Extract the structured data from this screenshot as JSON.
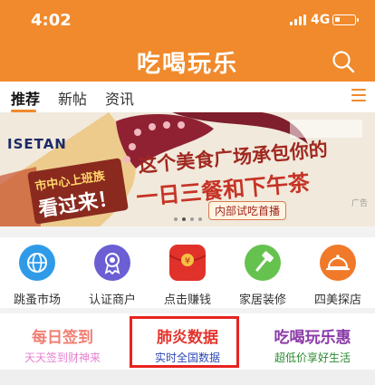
{
  "status_bar": {
    "time": "4:02",
    "network": "4G"
  },
  "header": {
    "title": "吃喝玩乐"
  },
  "tabs": [
    {
      "label": "推荐",
      "active": true
    },
    {
      "label": "新帖",
      "active": false
    },
    {
      "label": "资讯",
      "active": false
    }
  ],
  "banner": {
    "brand": "ISETAN",
    "left_line1": "市中心上班族",
    "left_line2": "看过来！",
    "title": "这个美食广场承包你的",
    "subtitle": "一日三餐和下午茶",
    "tag": "内部试吃首播",
    "ad_label": "广告"
  },
  "quick_links": [
    {
      "label": "跳蚤市场",
      "icon": "globe-icon",
      "color": "#2f9be8"
    },
    {
      "label": "认证商户",
      "icon": "badge-icon",
      "color": "#6b5fd3"
    },
    {
      "label": "点击赚钱",
      "icon": "red-envelope-icon",
      "color": "#e0322b"
    },
    {
      "label": "家居装修",
      "icon": "hammer-icon",
      "color": "#66c24f"
    },
    {
      "label": "四美探店",
      "icon": "cloche-icon",
      "color": "#f0792a"
    }
  ],
  "promos": [
    {
      "title": "每日签到",
      "subtitle": "天天签到财神来",
      "title_color": "#f07f73",
      "subtitle_color": "#e77fd0"
    },
    {
      "title": "肺炎数据",
      "subtitle": "实时全国数据",
      "title_color": "#e4352e",
      "subtitle_color": "#2d48b5"
    },
    {
      "title": "吃喝玩乐惠",
      "subtitle": "超低价享好生活",
      "title_color": "#8b3aa8",
      "subtitle_color": "#2a8a2f"
    }
  ],
  "colors": {
    "accent": "#f08a2c",
    "highlight_box": "#e8231f"
  }
}
